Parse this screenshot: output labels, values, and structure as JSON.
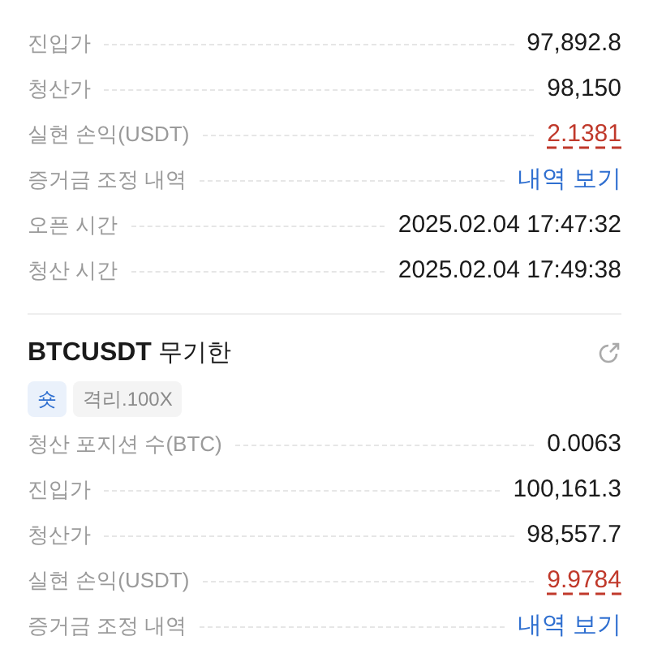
{
  "positions": [
    {
      "rows": [
        {
          "label": "진입가",
          "value": "97,892.8",
          "kind": "plain"
        },
        {
          "label": "청산가",
          "value": "98,150",
          "kind": "plain"
        },
        {
          "label": "실현 손익(USDT)",
          "value": "2.1381",
          "kind": "pnl"
        },
        {
          "label": "증거금 조정 내역",
          "value": "내역 보기",
          "kind": "link"
        },
        {
          "label": "오픈 시간",
          "value": "2025.02.04 17:47:32",
          "kind": "plain"
        },
        {
          "label": "청산 시간",
          "value": "2025.02.04 17:49:38",
          "kind": "plain"
        }
      ]
    },
    {
      "symbol": "BTCUSDT",
      "contract": "무기한",
      "side": "숏",
      "margin": "격리.100X",
      "rows": [
        {
          "label": "청산 포지션 수(BTC)",
          "value": "0.0063",
          "kind": "plain"
        },
        {
          "label": "진입가",
          "value": "100,161.3",
          "kind": "plain"
        },
        {
          "label": "청산가",
          "value": "98,557.7",
          "kind": "plain"
        },
        {
          "label": "실현 손익(USDT)",
          "value": "9.9784",
          "kind": "pnl"
        },
        {
          "label": "증거금 조정 내역",
          "value": "내역 보기",
          "kind": "link"
        }
      ]
    }
  ]
}
